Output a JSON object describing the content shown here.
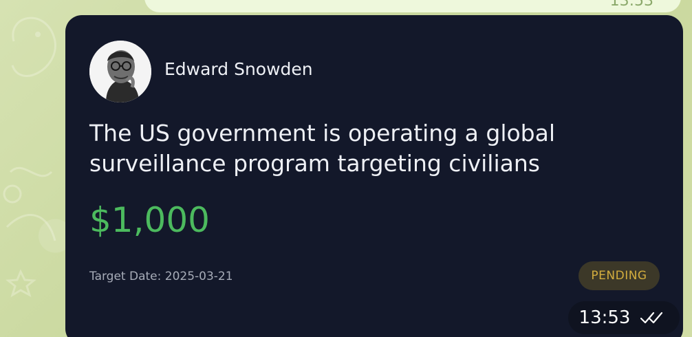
{
  "chat": {
    "previous_time": "13:53"
  },
  "message": {
    "author_name": "Edward Snowden",
    "claim_text": "The US government is operating a global surveillance program targeting civilians",
    "amount": "$1,000",
    "target_date": "Target Date: 2025-03-21",
    "status": "PENDING",
    "time": "13:53",
    "read_icon": "double-check-icon"
  },
  "colors": {
    "card_background": "#13182a",
    "amount_color": "#4cba5e",
    "status_color": "#d3ad3e",
    "wallpaper": "#cfdca4"
  }
}
